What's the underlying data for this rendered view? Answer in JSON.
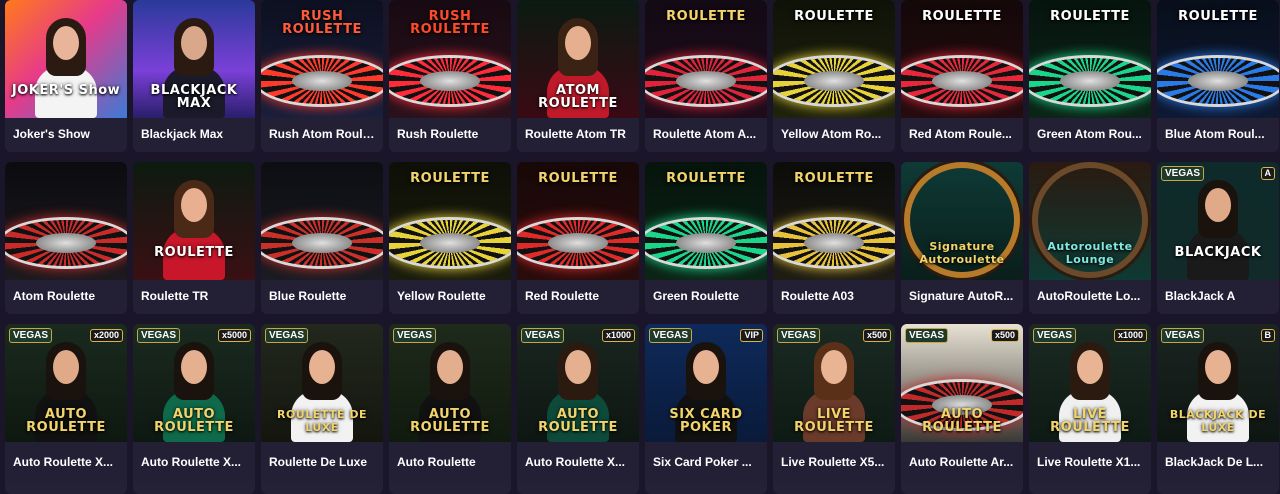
{
  "games": [
    {
      "title": "Joker's Show",
      "art": {
        "bg": "linear-gradient(135deg,#ff7a1a,#e73a8a 45%,#3b7bd6)",
        "text": "JOKER'S Show",
        "textColor": "#ffffff",
        "kind": "host",
        "skin": "#e8b49a",
        "outfit": "#f4f4f4",
        "hair": "#2a1a12"
      }
    },
    {
      "title": "Blackjack Max",
      "art": {
        "bg": "linear-gradient(180deg,#2a3a9a,#7a40d8 60%,#2a1e6a)",
        "text": "BLACKJACK MAX",
        "textColor": "#ffffff",
        "kind": "host",
        "skin": "#d9a88a",
        "outfit": "#1a1a2a",
        "hair": "#2a1a12"
      }
    },
    {
      "title": "Rush Atom Roulette",
      "art": {
        "bg": "linear-gradient(180deg,#0d1020,#1a1f3c)",
        "text": "RUSH ROULETTE",
        "textColor": "#ff5a3a",
        "kind": "wheel",
        "accent": "#ff3a2a"
      }
    },
    {
      "title": "Rush Roulette",
      "art": {
        "bg": "linear-gradient(180deg,#180a12,#2a121c)",
        "text": "RUSH ROULETTE",
        "textColor": "#ff4a2a",
        "kind": "wheel",
        "accent": "#ff2a3a"
      }
    },
    {
      "title": "Roulette Atom TR",
      "art": {
        "bg": "linear-gradient(180deg,#0a1a12,#3a0a14)",
        "text": "ATOM ROULETTE",
        "textColor": "#ffffff",
        "kind": "host",
        "skin": "#e6b090",
        "outfit": "#c01a2a",
        "hair": "#3a2214"
      }
    },
    {
      "title": "Roulette Atom A...",
      "art": {
        "bg": "linear-gradient(180deg,#120a14,#1e0c1a)",
        "text": "ROULETTE",
        "textColor": "#f2d46a",
        "kind": "wheel",
        "accent": "#e0233a"
      }
    },
    {
      "title": "Yellow Atom Ro...",
      "art": {
        "bg": "linear-gradient(180deg,#0f1208,#1f220c)",
        "text": "ROULETTE",
        "textColor": "#ffffff",
        "kind": "wheel",
        "accent": "#e8d23a"
      }
    },
    {
      "title": "Red Atom Roule...",
      "art": {
        "bg": "linear-gradient(180deg,#140809,#240c10)",
        "text": "ROULETTE",
        "textColor": "#ffffff",
        "kind": "wheel",
        "accent": "#e8283a"
      }
    },
    {
      "title": "Green Atom Rou...",
      "art": {
        "bg": "linear-gradient(180deg,#06140e,#0c2418)",
        "text": "ROULETTE",
        "textColor": "#ffffff",
        "kind": "wheel",
        "accent": "#1ad68a"
      }
    },
    {
      "title": "Blue Atom Roul...",
      "art": {
        "bg": "linear-gradient(180deg,#080e1a,#0e1a34)",
        "text": "ROULETTE",
        "textColor": "#ffffff",
        "kind": "wheel",
        "accent": "#2a7ae8"
      }
    },
    {
      "title": "Atom Roulette",
      "art": {
        "bg": "linear-gradient(180deg,#0c0c10,#1c1a1e)",
        "text": "",
        "textColor": "#ffffff",
        "kind": "wheel",
        "accent": "#c92a2a"
      }
    },
    {
      "title": "Roulette TR",
      "art": {
        "bg": "linear-gradient(180deg,#0c1a10,#3a1014)",
        "text": "ROULETTE",
        "textColor": "#ffffff",
        "kind": "host",
        "skin": "#e8b090",
        "outfit": "#c8162a",
        "hair": "#4a2a16"
      }
    },
    {
      "title": "Blue Roulette",
      "art": {
        "bg": "linear-gradient(180deg,#0c0e12,#1a1c22)",
        "text": "",
        "textColor": "#ffffff",
        "kind": "wheel",
        "accent": "#c9302a"
      }
    },
    {
      "title": "Yellow Roulette",
      "art": {
        "bg": "linear-gradient(180deg,#0e1008,#1a1c0c)",
        "text": "ROULETTE",
        "textColor": "#f2d46a",
        "kind": "wheel",
        "accent": "#e8d23a"
      }
    },
    {
      "title": "Red Roulette",
      "art": {
        "bg": "linear-gradient(180deg,#180808,#2a0c0c)",
        "text": "ROULETTE",
        "textColor": "#f2d46a",
        "kind": "wheel",
        "accent": "#e02a2a"
      }
    },
    {
      "title": "Green Roulette",
      "art": {
        "bg": "linear-gradient(180deg,#06140c,#0c2416)",
        "text": "ROULETTE",
        "textColor": "#f2d46a",
        "kind": "wheel",
        "accent": "#1ad68a"
      }
    },
    {
      "title": "Roulette A03",
      "art": {
        "bg": "linear-gradient(180deg,#0c0c0a,#1e1c14)",
        "text": "ROULETTE",
        "textColor": "#f2d46a",
        "kind": "wheel",
        "accent": "#e8c23a"
      }
    },
    {
      "title": "Signature AutoR...",
      "art": {
        "bg": "linear-gradient(180deg,#0e3a36,#0a1e1a)",
        "text": "Signature Autoroulette",
        "textColor": "#f2d46a",
        "kind": "autowheel",
        "accent": "#b57a2a"
      }
    },
    {
      "title": "AutoRoulette Lo...",
      "art": {
        "bg": "linear-gradient(180deg,#2a1a10,#0e3a34)",
        "text": "Autoroulette Lounge",
        "textColor": "#7fe8e0",
        "kind": "autowheel",
        "accent": "#6a4a2a"
      }
    },
    {
      "title": "BlackJack A",
      "art": {
        "bg": "linear-gradient(180deg,#0e2a2a,#122a2a)",
        "text": "BLACKJACK",
        "textColor": "#ffffff",
        "kind": "vegas",
        "badge": "VEGAS",
        "mult": "A",
        "skin": "#e0aa88",
        "outfit": "#1a1a1a",
        "hair": "#1a120c"
      }
    },
    {
      "title": "Auto Roulette X...",
      "art": {
        "bg": "linear-gradient(180deg,#1a2a1e,#0e1810)",
        "text": "AUTO ROULETTE",
        "textColor": "#f2d46a",
        "kind": "vegas",
        "badge": "VEGAS",
        "mult": "x2000",
        "skin": "#e0aa88",
        "outfit": "#111111",
        "hair": "#1a120c"
      }
    },
    {
      "title": "Auto Roulette X...",
      "art": {
        "bg": "linear-gradient(180deg,#1a2a20,#0e1812)",
        "text": "AUTO ROULETTE",
        "textColor": "#f2d46a",
        "kind": "vegas",
        "badge": "VEGAS",
        "mult": "x5000",
        "skin": "#e4b090",
        "outfit": "#0e6a4a",
        "hair": "#1a120c"
      }
    },
    {
      "title": "Roulette De Luxe",
      "art": {
        "bg": "linear-gradient(180deg,#22281e,#14160e)",
        "text": "ROULETTE DE LUXE",
        "textColor": "#f2d46a",
        "kind": "vegas",
        "badge": "VEGAS",
        "mult": "",
        "skin": "#e6b292",
        "outfit": "#f2f2f2",
        "hair": "#1a120c"
      }
    },
    {
      "title": "Auto Roulette",
      "art": {
        "bg": "linear-gradient(180deg,#1e2a1c,#101a0e)",
        "text": "AUTO ROULETTE",
        "textColor": "#f2d46a",
        "kind": "vegas",
        "badge": "VEGAS",
        "mult": "",
        "skin": "#e2ae8e",
        "outfit": "#111111",
        "hair": "#1a120c"
      }
    },
    {
      "title": "Auto Roulette X...",
      "art": {
        "bg": "linear-gradient(180deg,#1a2620,#0e1612)",
        "text": "AUTO ROULETTE",
        "textColor": "#f2d46a",
        "kind": "vegas",
        "badge": "VEGAS",
        "mult": "x1000",
        "skin": "#e4b090",
        "outfit": "#0e4a3a",
        "hair": "#2a1a10"
      }
    },
    {
      "title": "Six Card Poker ...",
      "art": {
        "bg": "linear-gradient(180deg,#0e2a5a,#0a1a3a)",
        "text": "SIX CARD POKER",
        "textColor": "#f2d46a",
        "kind": "vegas",
        "badge": "VEGAS",
        "mult": "VIP",
        "skin": "#e6b292",
        "outfit": "#111111",
        "hair": "#1a120c"
      }
    },
    {
      "title": "Live Roulette X5...",
      "art": {
        "bg": "linear-gradient(180deg,#1a2a22,#0e1a14)",
        "text": "LIVE ROULETTE",
        "textColor": "#f2d46a",
        "kind": "vegas",
        "badge": "VEGAS",
        "mult": "x500",
        "skin": "#e8b494",
        "outfit": "#6a3a2a",
        "hair": "#5a3018"
      }
    },
    {
      "title": "Auto Roulette Ar...",
      "art": {
        "bg": "linear-gradient(180deg,#e8e2d4,#3a3a36)",
        "text": "AUTO ROULETTE",
        "textColor": "#f2d46a",
        "kind": "vegaswheel",
        "badge": "VEGAS",
        "mult": "x500",
        "accent": "#c02a2a"
      }
    },
    {
      "title": "Live Roulette X1...",
      "art": {
        "bg": "linear-gradient(180deg,#1a2a22,#0e1a14)",
        "text": "LIVE ROULETTE",
        "textColor": "#f2d46a",
        "kind": "vegas",
        "badge": "VEGAS",
        "mult": "x1000",
        "skin": "#e8b494",
        "outfit": "#f0f0f0",
        "hair": "#2a1a10"
      }
    },
    {
      "title": "BlackJack De L...",
      "art": {
        "bg": "linear-gradient(180deg,#1a2420,#0e1612)",
        "text": "BLACKJACK DE LUXE",
        "textColor": "#f2d46a",
        "kind": "vegas",
        "badge": "VEGAS",
        "mult": "B",
        "skin": "#e6b292",
        "outfit": "#f2f2f2",
        "hair": "#1a120c"
      }
    }
  ]
}
